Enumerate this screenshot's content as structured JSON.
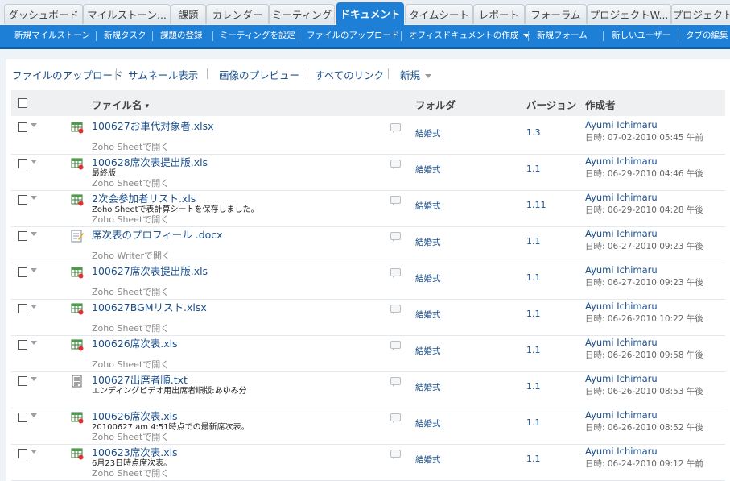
{
  "tabs": [
    "ダッシュボード",
    "マイルストーン...",
    "課題",
    "カレンダー",
    "ミーティング",
    "ドキュメント",
    "タイムシート",
    "レポート",
    "フォーラム",
    "プロジェクトW...",
    "プロジェクト"
  ],
  "actions": [
    "新規マイルストーン",
    "新規タスク",
    "課題の登録",
    "ミーティングを設定",
    "ファイルのアップロード",
    "オフィスドキュメントの作成",
    "新規フォーム",
    "新しいユーザー",
    "タブの編集"
  ],
  "toolbar": [
    "ファイルのアップロード",
    "サムネール表示",
    "画像のプレビュー",
    "すべてのリンク",
    "新規"
  ],
  "headers": {
    "name": "ファイル名",
    "folder": "フォルダ",
    "version": "バージョン",
    "author": "作成者"
  },
  "colors": {
    "accent": "#1d7fd6",
    "link": "#1a4f8c"
  },
  "files": [
    {
      "icon": "sheet-icon",
      "name": "100627お車代対象者.xlsx",
      "desc": "",
      "open": "Zoho Sheetで開く",
      "folder": "結婚式",
      "version": "1.3",
      "author": "Ayumi Ichimaru",
      "date": "日時: 07-02-2010 05:45 午前"
    },
    {
      "icon": "sheet-icon",
      "name": "100628席次表提出版.xls",
      "desc": "最終版",
      "open": "Zoho Sheetで開く",
      "folder": "結婚式",
      "version": "1.1",
      "author": "Ayumi Ichimaru",
      "date": "日時: 06-29-2010 04:46 午後"
    },
    {
      "icon": "sheet-icon",
      "name": "2次会参加者リスト.xls",
      "desc": "Zoho Sheetで表計算シートを保存しました。",
      "open": "Zoho Sheetで開く",
      "folder": "結婚式",
      "version": "1.11",
      "author": "Ayumi Ichimaru",
      "date": "日時: 06-29-2010 04:28 午後"
    },
    {
      "icon": "writer-icon",
      "name": "席次表のプロフィール .docx",
      "desc": "",
      "open": "Zoho Writerで開く",
      "folder": "結婚式",
      "version": "1.1",
      "author": "Ayumi Ichimaru",
      "date": "日時: 06-27-2010 09:23 午後"
    },
    {
      "icon": "sheet-icon",
      "name": "100627席次表提出版.xls",
      "desc": "",
      "open": "Zoho Sheetで開く",
      "folder": "結婚式",
      "version": "1.1",
      "author": "Ayumi Ichimaru",
      "date": "日時: 06-27-2010 09:23 午後"
    },
    {
      "icon": "sheet-icon",
      "name": "100627BGMリスト.xlsx",
      "desc": "",
      "open": "Zoho Sheetで開く",
      "folder": "結婚式",
      "version": "1.1",
      "author": "Ayumi Ichimaru",
      "date": "日時: 06-26-2010 10:22 午後"
    },
    {
      "icon": "sheet-icon",
      "name": "100626席次表.xls",
      "desc": "",
      "open": "Zoho Sheetで開く",
      "folder": "結婚式",
      "version": "1.1",
      "author": "Ayumi Ichimaru",
      "date": "日時: 06-26-2010 09:58 午後"
    },
    {
      "icon": "text-icon",
      "name": "100627出席者順.txt",
      "desc": "エンディングビデオ用出席者順版:あゆみ分",
      "open": "",
      "folder": "結婚式",
      "version": "1.1",
      "author": "Ayumi Ichimaru",
      "date": "日時: 06-26-2010 08:53 午後"
    },
    {
      "icon": "sheet-icon",
      "name": "100626席次表.xls",
      "desc": "20100627 am 4:51時点での最新席次表。",
      "open": "Zoho Sheetで開く",
      "folder": "結婚式",
      "version": "1.1",
      "author": "Ayumi Ichimaru",
      "date": "日時: 06-26-2010 08:52 午後"
    },
    {
      "icon": "sheet-icon",
      "name": "100623席次表.xls",
      "desc": "6月23日時点席次表。",
      "open": "Zoho Sheetで開く",
      "folder": "結婚式",
      "version": "1.1",
      "author": "Ayumi Ichimaru",
      "date": "日時: 06-24-2010 09:12 午前"
    }
  ]
}
